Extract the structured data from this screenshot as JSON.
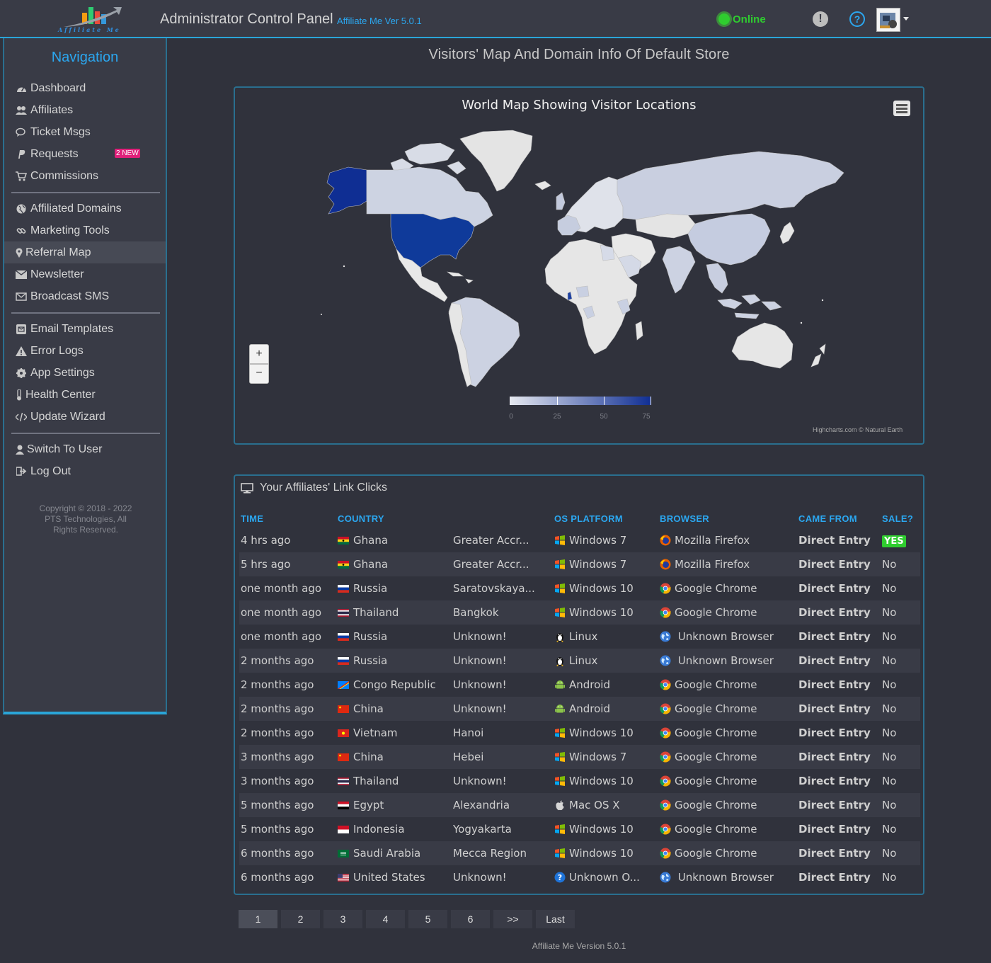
{
  "header": {
    "logo_text": "Affiliate Me",
    "title": "Administrator Control Panel",
    "version": "Affiliate Me Ver 5.0.1",
    "status": "Online",
    "alert_icon": "exclamation-circle-icon",
    "help_icon": "question-circle-icon",
    "colors": {
      "accent": "#2ba7f0",
      "online": "#2fcd2f",
      "bar": "#393b46"
    }
  },
  "sidebar": {
    "title": "Navigation",
    "items": [
      {
        "label": "Dashboard",
        "icon": "dashboard-icon"
      },
      {
        "label": "Affiliates",
        "icon": "users-icon"
      },
      {
        "label": "Ticket Msgs",
        "icon": "comments-icon"
      },
      {
        "label": "Requests",
        "icon": "paypal-icon",
        "badge": "2 NEW"
      },
      {
        "label": "Commissions",
        "icon": "cart-icon"
      },
      {
        "label": "Affiliated Domains",
        "icon": "globe-icon"
      },
      {
        "label": "Marketing Tools",
        "icon": "link-icon"
      },
      {
        "label": "Referral Map",
        "icon": "map-marker-icon"
      },
      {
        "label": "Newsletter",
        "icon": "envelope-icon"
      },
      {
        "label": "Broadcast SMS",
        "icon": "envelope-open-icon"
      },
      {
        "label": "Email Templates",
        "icon": "envelope-square-icon"
      },
      {
        "label": "Error Logs",
        "icon": "warning-icon"
      },
      {
        "label": "App Settings",
        "icon": "gear-icon"
      },
      {
        "label": "Health Center",
        "icon": "thermometer-icon"
      },
      {
        "label": "Update Wizard",
        "icon": "code-icon"
      },
      {
        "label": "Switch To User",
        "icon": "user-icon"
      },
      {
        "label": "Log Out",
        "icon": "sign-out-icon"
      }
    ],
    "active_item": "Referral Map",
    "copyright": "Copyright © 2018 - 2022 PTS Technologies, All Rights Reserved."
  },
  "page": {
    "title": "Visitors' Map And Domain Info Of Default Store"
  },
  "map": {
    "title": "World Map Showing Visitor Locations",
    "menu_icon": "hamburger-menu-icon",
    "zoom_in": "+",
    "zoom_out": "−",
    "legend_labels": [
      "0",
      "25",
      "50",
      "75"
    ],
    "legend_colors": {
      "min": "#e6e9f0",
      "max": "#0f2e93"
    },
    "credit": "Highcharts.com © Natural Earth"
  },
  "clicks": {
    "title": "Your Affiliates' Link Clicks",
    "icon": "monitor-icon",
    "columns": [
      "TIME",
      "COUNTRY",
      "",
      "OS PLATFORM",
      "BROWSER",
      "CAME FROM",
      "SALE?"
    ],
    "rows": [
      {
        "time": "4 hrs ago",
        "country": "Ghana",
        "flag": "gh",
        "region": "Greater Accr...",
        "os": "Windows 7",
        "os_icon": "windows",
        "browser": "Mozilla Firefox",
        "br_icon": "firefox",
        "came_from": "Direct Entry",
        "sale": "YES"
      },
      {
        "time": "5 hrs ago",
        "country": "Ghana",
        "flag": "gh",
        "region": "Greater Accr...",
        "os": "Windows 7",
        "os_icon": "windows",
        "browser": "Mozilla Firefox",
        "br_icon": "firefox",
        "came_from": "Direct Entry",
        "sale": "No"
      },
      {
        "time": "one month ago",
        "country": "Russia",
        "flag": "ru",
        "region": "Saratovskaya...",
        "os": "Windows 10",
        "os_icon": "windows",
        "browser": "Google Chrome",
        "br_icon": "chrome",
        "came_from": "Direct Entry",
        "sale": "No"
      },
      {
        "time": "one month ago",
        "country": "Thailand",
        "flag": "th",
        "region": "Bangkok",
        "os": "Windows 10",
        "os_icon": "windows",
        "browser": "Google Chrome",
        "br_icon": "chrome",
        "came_from": "Direct Entry",
        "sale": "No"
      },
      {
        "time": "one month ago",
        "country": "Russia",
        "flag": "ru",
        "region": "Unknown!",
        "os": "Linux",
        "os_icon": "linux",
        "browser": " Unknown Browser",
        "br_icon": "globe",
        "came_from": "Direct Entry",
        "sale": "No"
      },
      {
        "time": "2 months ago",
        "country": "Russia",
        "flag": "ru",
        "region": "Unknown!",
        "os": "Linux",
        "os_icon": "linux",
        "browser": " Unknown Browser",
        "br_icon": "globe",
        "came_from": "Direct Entry",
        "sale": "No"
      },
      {
        "time": "2 months ago",
        "country": "Congo Republic",
        "flag": "cg",
        "region": "Unknown!",
        "os": "Android",
        "os_icon": "android",
        "browser": "Google Chrome",
        "br_icon": "chrome",
        "came_from": "Direct Entry",
        "sale": "No"
      },
      {
        "time": "2 months ago",
        "country": "China",
        "flag": "cn",
        "region": "Unknown!",
        "os": "Android",
        "os_icon": "android",
        "browser": "Google Chrome",
        "br_icon": "chrome",
        "came_from": "Direct Entry",
        "sale": "No"
      },
      {
        "time": "2 months ago",
        "country": "Vietnam",
        "flag": "vn",
        "region": "Hanoi",
        "os": "Windows 10",
        "os_icon": "windows",
        "browser": "Google Chrome",
        "br_icon": "chrome",
        "came_from": "Direct Entry",
        "sale": "No"
      },
      {
        "time": "3 months ago",
        "country": "China",
        "flag": "cn",
        "region": "Hebei",
        "os": "Windows 7",
        "os_icon": "windows",
        "browser": "Google Chrome",
        "br_icon": "chrome",
        "came_from": "Direct Entry",
        "sale": "No"
      },
      {
        "time": "3 months ago",
        "country": "Thailand",
        "flag": "th",
        "region": "Unknown!",
        "os": "Windows 10",
        "os_icon": "windows",
        "browser": "Google Chrome",
        "br_icon": "chrome",
        "came_from": "Direct Entry",
        "sale": "No"
      },
      {
        "time": "5 months ago",
        "country": "Egypt",
        "flag": "eg",
        "region": "Alexandria",
        "os": "Mac OS X",
        "os_icon": "apple",
        "browser": "Google Chrome",
        "br_icon": "chrome",
        "came_from": "Direct Entry",
        "sale": "No"
      },
      {
        "time": "5 months ago",
        "country": "Indonesia",
        "flag": "id",
        "region": "Yogyakarta",
        "os": "Windows 10",
        "os_icon": "windows",
        "browser": "Google Chrome",
        "br_icon": "chrome",
        "came_from": "Direct Entry",
        "sale": "No"
      },
      {
        "time": "6 months ago",
        "country": "Saudi Arabia",
        "flag": "sa",
        "region": "Mecca Region",
        "os": "Windows 10",
        "os_icon": "windows",
        "browser": "Google Chrome",
        "br_icon": "chrome",
        "came_from": "Direct Entry",
        "sale": "No"
      },
      {
        "time": "6 months ago",
        "country": "United States",
        "flag": "us",
        "region": "Unknown!",
        "os": "Unknown O...",
        "os_icon": "question",
        "browser": " Unknown Browser",
        "br_icon": "globe",
        "came_from": "Direct Entry",
        "sale": "No"
      }
    ]
  },
  "pagination": {
    "pages": [
      "1",
      "2",
      "3",
      "4",
      "5",
      "6",
      ">>",
      "Last"
    ],
    "active": "1"
  },
  "footer": {
    "version": "Affiliate Me Version 5.0.1"
  }
}
